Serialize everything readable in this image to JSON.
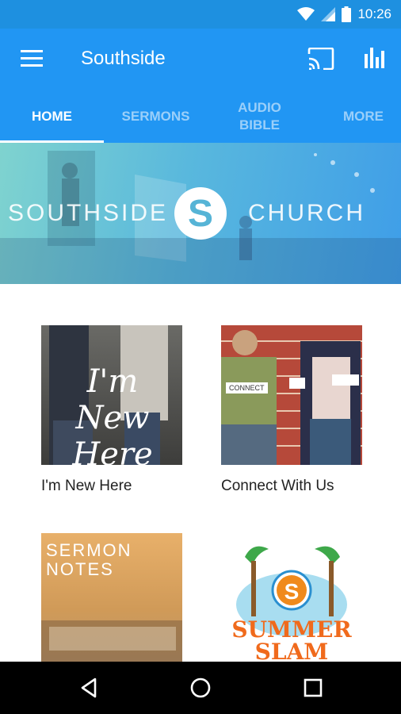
{
  "status": {
    "time": "10:26"
  },
  "app": {
    "title": "Southside"
  },
  "tabs": [
    {
      "label": "HOME",
      "active": true
    },
    {
      "label": "SERMONS",
      "active": false
    },
    {
      "label": "AUDIO\nBIBLE",
      "active": false
    },
    {
      "label": "MORE",
      "active": false
    }
  ],
  "banner": {
    "left_word": "SOUTHSIDE",
    "right_word": "CHURCH",
    "logo_letter": "S"
  },
  "tiles": [
    {
      "label": "I'm New Here",
      "art_text": "I'm New Here"
    },
    {
      "label": "Connect With Us",
      "art_text": "CONNECT"
    },
    {
      "label": "",
      "art_text": "SERMON NOTES"
    },
    {
      "label": "",
      "art_text": "SUMMER SLAM"
    }
  ],
  "icons": {
    "menu": "hamburger-icon",
    "cast": "cast-icon",
    "stats": "bar-chart-icon",
    "wifi": "wifi-icon",
    "signal": "signal-icon",
    "battery": "battery-icon",
    "back": "back-icon",
    "home": "home-icon",
    "recents": "recents-icon"
  },
  "colors": {
    "statusbar": "#1e90e0",
    "appbar": "#2196f3",
    "navbar": "#000000"
  }
}
